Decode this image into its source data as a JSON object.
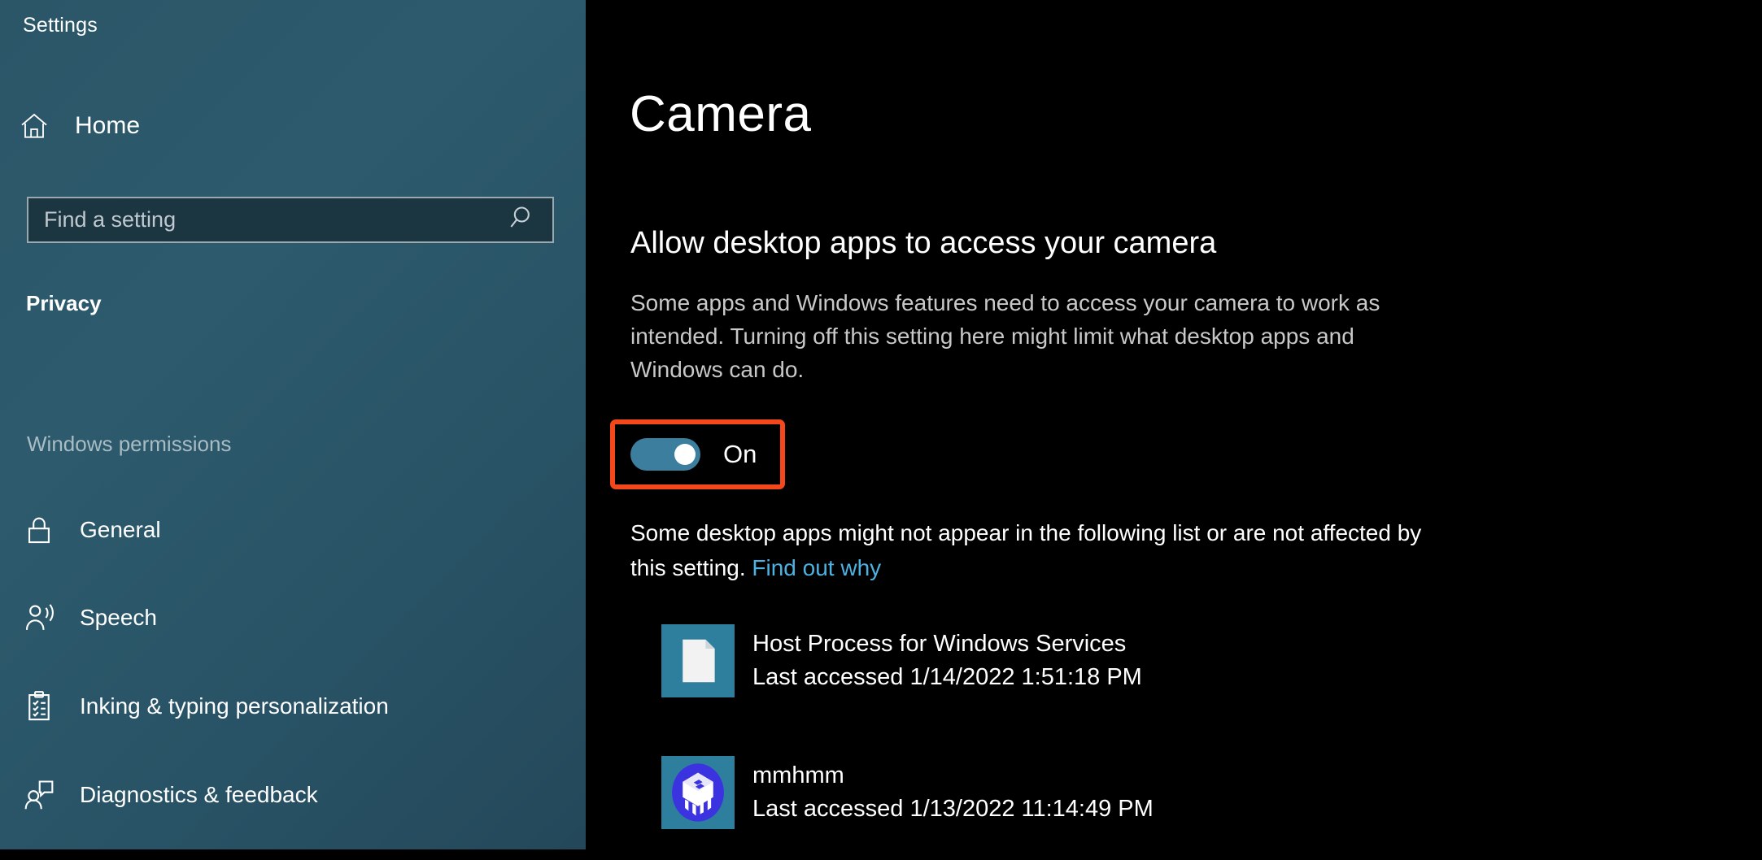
{
  "window": {
    "title": "Settings",
    "controls": {
      "minimize": "minimize-icon",
      "maximize": "maximize-icon",
      "close": "close-icon"
    }
  },
  "sidebar": {
    "home_label": "Home",
    "home_icon": "home-icon",
    "search": {
      "placeholder": "Find a setting",
      "value": "",
      "icon": "search-icon"
    },
    "category": "Privacy",
    "group_label": "Windows permissions",
    "items": [
      {
        "label": "General",
        "icon": "lock-icon"
      },
      {
        "label": "Speech",
        "icon": "person-speaking-icon"
      },
      {
        "label": "Inking & typing personalization",
        "icon": "clipboard-checklist-icon"
      },
      {
        "label": "Diagnostics & feedback",
        "icon": "person-feedback-icon"
      }
    ]
  },
  "main": {
    "page_title": "Camera",
    "section_heading": "Allow desktop apps to access your camera",
    "section_description": "Some apps and Windows features need to access your camera to work as intended. Turning off this setting here might limit what desktop apps and Windows can do.",
    "toggle": {
      "state_label": "On",
      "checked": true,
      "highlighted": true,
      "track_color": "#3c7e9e",
      "highlight_color": "#f4471c"
    },
    "list_note_text": "Some desktop apps might not appear in the following list or are not affected by this setting. ",
    "list_note_link": "Find out why",
    "link_color": "#4cb2e2",
    "apps": [
      {
        "name": "Host Process for Windows Services",
        "last_accessed": "Last accessed 1/14/2022 1:51:18 PM",
        "icon": "document-app-icon",
        "icon_bg": "#2e7f9e"
      },
      {
        "name": "mmhmm",
        "last_accessed": "Last accessed 1/13/2022 11:14:49 PM",
        "icon": "mmhmm-app-icon",
        "icon_bg": "#2e7f9e"
      }
    ]
  }
}
